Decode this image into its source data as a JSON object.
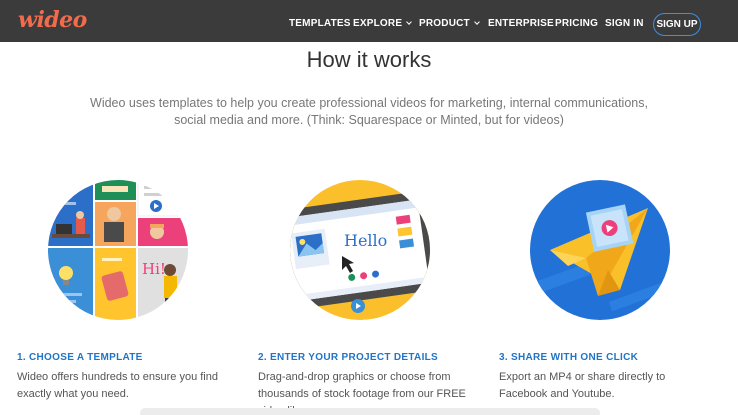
{
  "header": {
    "logo": "wideo",
    "nav": {
      "templates": "TEMPLATES",
      "explore": "EXPLORE",
      "product": "PRODUCT",
      "enterprise": "ENTERPRISE",
      "pricing": "PRICING",
      "sign_in": "SIGN IN",
      "sign_up": "SIGN UP"
    }
  },
  "main": {
    "title": "How it works",
    "intro_line1": "Wideo uses templates to help you create professional videos for marketing, internal communications,",
    "intro_line2": "social media and more. (Think: Squarespace or Minted, but for videos)"
  },
  "steps": [
    {
      "title": "1. CHOOSE A TEMPLATE",
      "desc_line1": "Wideo offers hundreds to ensure you find",
      "desc_line2": "exactly what you need.",
      "art": {
        "hi_text": "Hi!"
      }
    },
    {
      "title": "2. ENTER YOUR PROJECT DETAILS",
      "desc_line1": "Drag-and-drop graphics or choose from",
      "desc_line2": "thousands of stock footage from our FREE",
      "desc_line3": "video library.",
      "art": {
        "hello_text": "Hello"
      }
    },
    {
      "title": "3. SHARE WITH ONE CLICK",
      "desc_line1": "Export an MP4 or share directly to",
      "desc_line2": "Facebook and Youtube."
    }
  ],
  "colors": {
    "header_bg": "#3b3b3b",
    "logo": "#f26b4b",
    "link_blue": "#2274c5",
    "signup_border": "#3d8fe0"
  }
}
